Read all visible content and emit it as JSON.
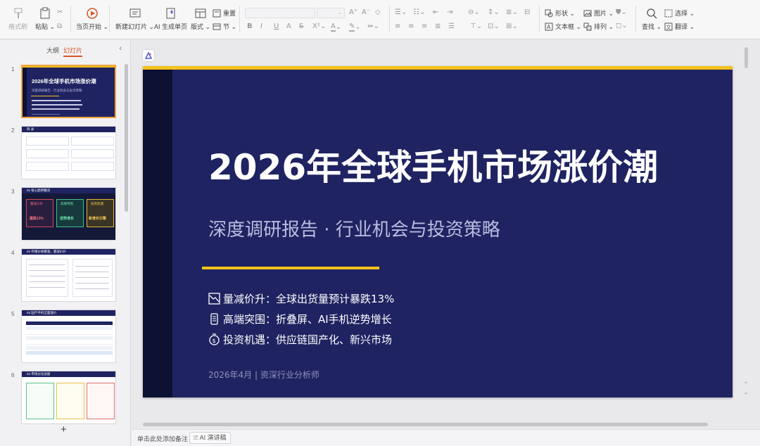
{
  "ribbon": {
    "format_painter": "格式刷",
    "paste": "粘贴",
    "play_from_current": "当页开始",
    "new_slide": "新建幻灯片",
    "ai_single_page": "AI 生成单页",
    "layout": "版式",
    "reset": "重置",
    "section": "节",
    "shape": "形状",
    "picture": "图片",
    "textbox": "文本框",
    "arrange": "排列",
    "find": "查找",
    "select": "选择",
    "translate": "翻译"
  },
  "left_panel": {
    "tab_outline": "大纲",
    "tab_slides": "幻灯片",
    "slide_numbers": [
      "1",
      "2",
      "3",
      "4",
      "5",
      "6"
    ]
  },
  "thumbnails": {
    "s1": {
      "title": "2026年全球手机市场涨价潮",
      "subtitle": "深度调研报告 · 行业机会与投资策略"
    },
    "s2": {
      "title": "目 录"
    },
    "s3": {
      "title": "01 核心趋势概览",
      "c1": "量减价升",
      "c2": "高端突围",
      "c3": "投资机遇",
      "v1": "暴跌13%",
      "v2": "逆势增长",
      "v3": "新增长引擎"
    },
    "s4": {
      "title": "02 存储价格暴涨，量减价升"
    },
    "s5": {
      "title": "03 国产手机全面涨价"
    },
    "s6": {
      "title": "04 市场分化加速"
    }
  },
  "slide": {
    "title": "2026年全球手机市场涨价潮",
    "subtitle": "深度调研报告 · 行业机会与投资策略",
    "bullets": [
      "量减价升：全球出货量预计暴跌13%",
      "高端突围：折叠屏、AI手机逆势增长",
      "投资机遇：供应链国产化、新兴市场"
    ],
    "footer": "2026年4月 | 资深行业分析师"
  },
  "notes": {
    "hint": "单击此处添加备注",
    "ai_button": "AI 演讲稿"
  },
  "colors": {
    "slide_bg": "#1f2361",
    "accent": "#f5c21b",
    "selection": "#f0a23a",
    "tab_active": "#d8562a"
  }
}
